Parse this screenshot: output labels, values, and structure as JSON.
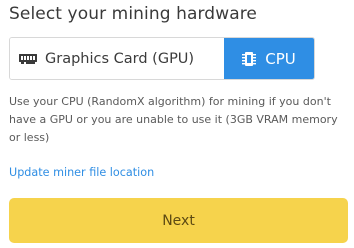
{
  "header": {
    "title": "Select your mining hardware"
  },
  "hardware_options": [
    {
      "label": "Graphics Card (GPU)",
      "icon": "graphics-card-icon",
      "selected": false
    },
    {
      "label": "CPU",
      "icon": "cpu-chip-icon",
      "selected": true
    }
  ],
  "description": "Use your CPU (RandomX algorithm) for mining if you don't have a GPU or you are unable to use it (3GB VRAM memory or less)",
  "update_link": "Update miner file location",
  "next_label": "Next",
  "colors": {
    "accent": "#2f8ee4",
    "next_button": "#f6d34c",
    "border": "#d8d8d8"
  }
}
